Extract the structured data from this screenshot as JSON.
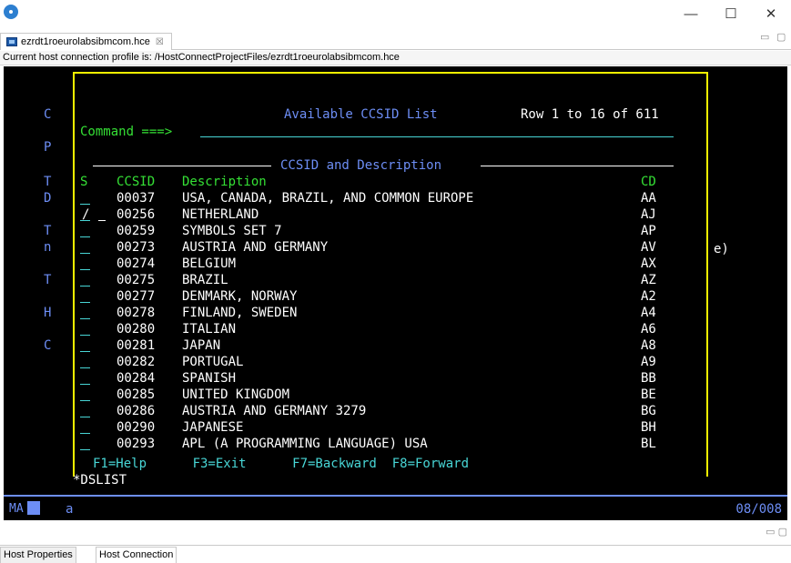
{
  "window": {
    "app_icon": "app-logo-icon",
    "minimize": "—",
    "maximize": "☐",
    "close": "✕"
  },
  "tab": {
    "label": "ezrdt1roeurolabsibmcom.hce",
    "close": "☒",
    "icon": "terminal-file-icon"
  },
  "profile_bar": "Current host connection profile is: /HostConnectProjectFiles/ezrdt1roeurolabsibmcom.hce",
  "terminal": {
    "side_letters": [
      "C",
      "P",
      "T",
      "D",
      "T",
      "n",
      "T",
      "H",
      "C"
    ],
    "side_right": "e)",
    "title": "Available CCSID List",
    "row_info": "Row 1 to 16 of 611",
    "command_label": "Command ===>",
    "section_title": "CCSID and Description",
    "headers": {
      "s": "S",
      "ccsid": "CCSID",
      "description": "Description",
      "cd": "CD"
    },
    "rows": [
      {
        "ccsid": "00037",
        "description": "USA, CANADA, BRAZIL, AND COMMON EUROPE",
        "cd": "AA"
      },
      {
        "ccsid": "00256",
        "description": "NETHERLAND",
        "cd": "AJ"
      },
      {
        "ccsid": "00259",
        "description": "SYMBOLS SET 7",
        "cd": "AP"
      },
      {
        "ccsid": "00273",
        "description": "AUSTRIA AND GERMANY",
        "cd": "AV"
      },
      {
        "ccsid": "00274",
        "description": "BELGIUM",
        "cd": "AX"
      },
      {
        "ccsid": "00275",
        "description": "BRAZIL",
        "cd": "AZ"
      },
      {
        "ccsid": "00277",
        "description": "DENMARK, NORWAY",
        "cd": "A2"
      },
      {
        "ccsid": "00278",
        "description": "FINLAND, SWEDEN",
        "cd": "A4"
      },
      {
        "ccsid": "00280",
        "description": "ITALIAN",
        "cd": "A6"
      },
      {
        "ccsid": "00281",
        "description": "JAPAN",
        "cd": "A8"
      },
      {
        "ccsid": "00282",
        "description": "PORTUGAL",
        "cd": "A9"
      },
      {
        "ccsid": "00284",
        "description": "SPANISH",
        "cd": "BB"
      },
      {
        "ccsid": "00285",
        "description": "UNITED KINGDOM",
        "cd": "BE"
      },
      {
        "ccsid": "00286",
        "description": "AUSTRIA AND GERMANY 3279",
        "cd": "BG"
      },
      {
        "ccsid": "00290",
        "description": "JAPANESE",
        "cd": "BH"
      },
      {
        "ccsid": "00293",
        "description": "APL (A PROGRAMMING LANGUAGE) USA",
        "cd": "BL"
      }
    ],
    "selected_mark": "/",
    "fkeys": "F1=Help      F3=Exit      F7=Backward  F8=Forward",
    "dslist": "*DSLIST"
  },
  "oia": {
    "ma": "MA",
    "input": "a",
    "position": "08/008"
  },
  "bottom_tabs": [
    "Host Properties",
    "Host Connection"
  ],
  "colors": {
    "blue": "#6d8ef5",
    "green": "#35e035",
    "turquoise": "#48d6d6",
    "yellow": "#f2f200",
    "white": "#ffffff",
    "background": "#000000"
  }
}
